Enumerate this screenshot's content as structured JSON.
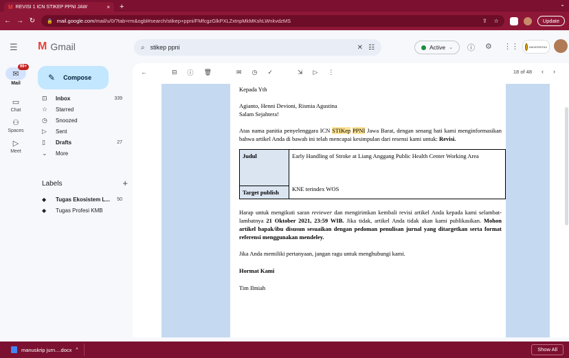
{
  "browser": {
    "tab_title": "REVISI 1 ICN STIKEP PPNI JAW",
    "tab_close": "×",
    "new_tab": "+",
    "url_host": "mail.google.com",
    "url_path": "/mail/u/0/?tab=rm&ogbl#search/stikep+ppni/FMfcgzGlkPXLZxtnpMkMKshLWnkvdzMS",
    "update_label": "Update"
  },
  "header": {
    "app_name": "Gmail",
    "search_query": "stikep ppni",
    "status_label": "Active",
    "org_badge_text": "UNIVERSITAS"
  },
  "rail": {
    "mail_label": "Mail",
    "mail_badge": "99+",
    "chat_label": "Chat",
    "spaces_label": "Spaces",
    "meet_label": "Meet"
  },
  "nav": {
    "compose_label": "Compose",
    "items": [
      {
        "label": "Inbox",
        "count": "339"
      },
      {
        "label": "Starred",
        "count": ""
      },
      {
        "label": "Snoozed",
        "count": ""
      },
      {
        "label": "Sent",
        "count": ""
      },
      {
        "label": "Drafts",
        "count": "27"
      },
      {
        "label": "More",
        "count": ""
      }
    ],
    "labels_heading": "Labels",
    "labels": [
      {
        "label": "Tugas Ekosistem L...",
        "count": "50"
      },
      {
        "label": "Tugas Profesi KMB",
        "count": ""
      }
    ]
  },
  "mail": {
    "pager_text": "18 of 48",
    "greeting": "Kepada Yth",
    "recipients": "Agianto, Henni Devioni, Rismia Agustina",
    "salutation": "Salam Sejahtera!",
    "intro_1": "Atas nama panitia penyelenggara ICN ",
    "intro_hl1": "STIKep",
    "intro_2": " ",
    "intro_hl2": "PPNI",
    "intro_3": " Jawa Barat, dengan senang hati kami menginformasikan bahwa artikel Anda di bawah ini telah mencapai kesimpulan dari resensi kami untuk: ",
    "intro_result": "Revisi.",
    "table": {
      "judul_label": "Judul",
      "judul_value": "Early Handling of Stroke at Liang Anggang Public Health Center Working Area",
      "target_label": "Target publish",
      "target_value": "KNE terindex WOS"
    },
    "body_1": "Harap untuk mengikuti saran ",
    "body_reviewer": "reviewer",
    "body_2": " dan mengirimkan kembali revisi artikel Anda kepada kami selambat-lambatnya ",
    "body_deadline": "21 Oktober 2021, 23:59 WIB.",
    "body_3": " Jika tidak, artikel Anda tidak akan kami publikasikan. ",
    "body_bold": "Mohon artikel bapak/ibu disusun sesuaikan dengan pedoman penulisan jurnal yang ditargetkan serta format referensi menggunakan mendeley.",
    "questions": "Jika Anda memiliki pertanyaan, jangan ragu untuk menghubungi kami.",
    "closing": "Hormat Kami",
    "signature": "Tim Ilmiah"
  },
  "downloads": {
    "file_name": "manuskrip jurn....docx",
    "show_all": "Show All"
  }
}
